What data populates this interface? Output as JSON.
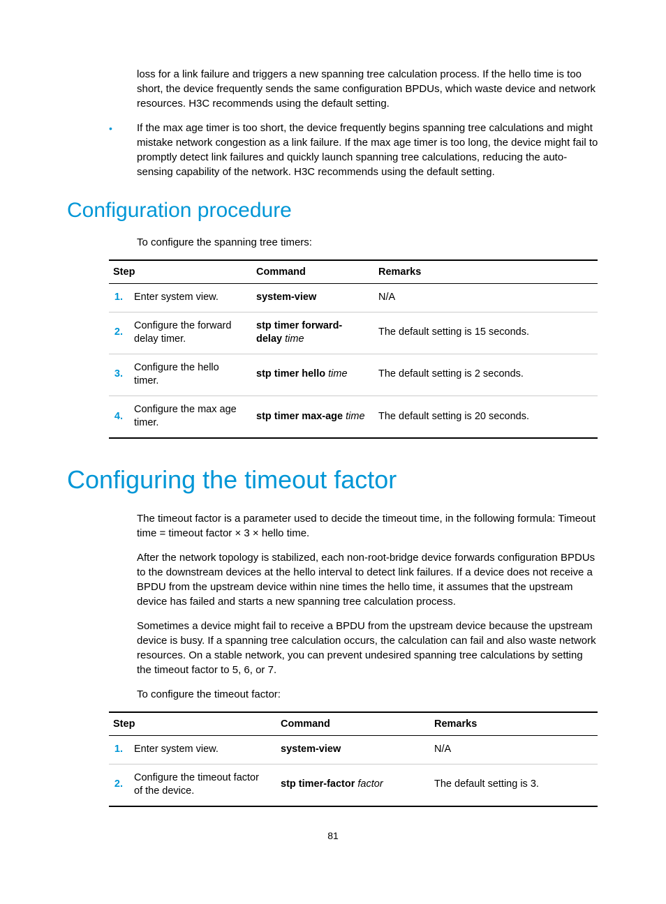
{
  "para1": "loss for a link failure and triggers a new spanning tree calculation process. If the hello time is too short, the device frequently sends the same configuration BPDUs, which waste device and network resources. H3C recommends using the default setting.",
  "bullet1": "If the max age timer is too short, the device frequently begins spanning tree calculations and might mistake network congestion as a link failure. If the max age timer is too long, the device might fail to promptly detect link failures and quickly launch spanning tree calculations, reducing the auto-sensing capability of the network. H3C recommends using the default setting.",
  "h2a": "Configuration procedure",
  "intro1": "To configure the spanning tree timers:",
  "table1": {
    "headers": {
      "step": "Step",
      "command": "Command",
      "remarks": "Remarks"
    },
    "rows": [
      {
        "num": "1.",
        "step": "Enter system view.",
        "cmd_b": "system-view",
        "cmd_i": "",
        "remarks": "N/A"
      },
      {
        "num": "2.",
        "step": "Configure the forward delay timer.",
        "cmd_b": "stp timer forward-delay",
        "cmd_i": "time",
        "remarks": "The default setting is 15 seconds."
      },
      {
        "num": "3.",
        "step": "Configure the hello timer.",
        "cmd_b": "stp timer hello",
        "cmd_i": "time",
        "remarks": "The default setting is 2 seconds."
      },
      {
        "num": "4.",
        "step": "Configure the max age timer.",
        "cmd_b": "stp timer max-age",
        "cmd_i": "time",
        "remarks": "The default setting is 20 seconds."
      }
    ]
  },
  "h1a": "Configuring the timeout factor",
  "para2": "The timeout factor is a parameter used to decide the timeout time, in the following formula: Timeout time = timeout factor × 3 × hello time.",
  "para3": "After the network topology is stabilized, each non-root-bridge device forwards configuration BPDUs to the downstream devices at the hello interval to detect link failures. If a device does not receive a BPDU from the upstream device within nine times the hello time, it assumes that the upstream device has failed and starts a new spanning tree calculation process.",
  "para4": "Sometimes a device might fail to receive a BPDU from the upstream device because the upstream device is busy. If a spanning tree calculation occurs, the calculation can fail and also waste network resources. On a stable network, you can prevent undesired spanning tree calculations by setting the timeout factor to 5, 6, or 7.",
  "intro2": "To configure the timeout factor:",
  "table2": {
    "headers": {
      "step": "Step",
      "command": "Command",
      "remarks": "Remarks"
    },
    "rows": [
      {
        "num": "1.",
        "step": "Enter system view.",
        "cmd_b": "system-view",
        "cmd_i": "",
        "remarks": "N/A"
      },
      {
        "num": "2.",
        "step": "Configure the timeout factor of the device.",
        "cmd_b": "stp timer-factor",
        "cmd_i": "factor",
        "remarks": "The default setting is 3."
      }
    ]
  },
  "pagenum": "81"
}
